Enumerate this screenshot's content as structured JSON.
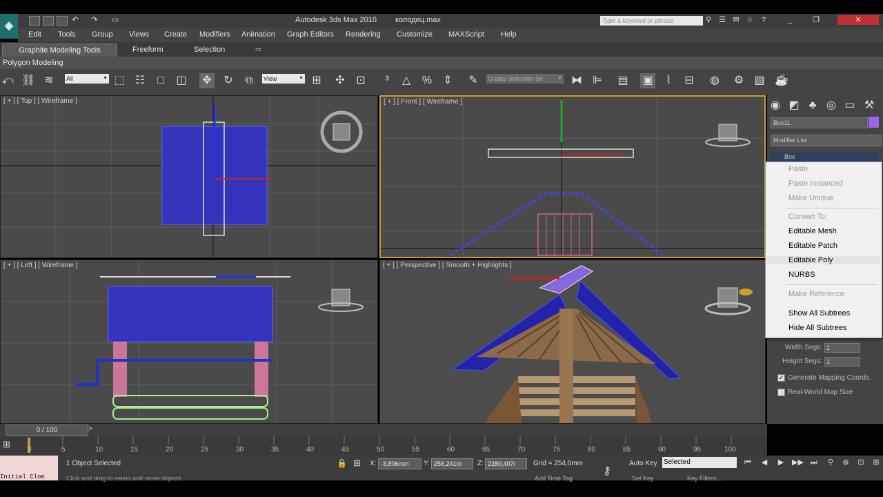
{
  "window": {
    "title": "Autodesk 3ds Max  2010",
    "file": "колодец.max",
    "search_placeholder": "Type a keyword or phrase"
  },
  "menu": [
    "Edit",
    "Tools",
    "Group",
    "Views",
    "Create",
    "Modifiers",
    "Animation",
    "Graph Editors",
    "Rendering",
    "Customize",
    "MAXScript",
    "Help"
  ],
  "ribbon": {
    "tabs": [
      "Graphite Modeling Tools",
      "Freeform",
      "Selection"
    ],
    "panel": "Polygon Modeling"
  },
  "toolbar": {
    "filter": "All",
    "ref_coord": "View",
    "named_selection": "Create Selection Se"
  },
  "viewports": {
    "top": "[ + ] [ Top ] [ Wireframe ]",
    "front": "[ + ] [ Front ] [ Wireframe ]",
    "left": "[ + ] [ Left ] [ Wireframe ]",
    "perspective": "[ + ] [ Perspective ] [ Smooth + Highlights ]"
  },
  "command_panel": {
    "object_name": "Box11",
    "modifier_list": "Modifier List",
    "stack_item": "Box",
    "object_color": "#9966ee",
    "params": {
      "width_segs_label": "Width Segs:",
      "width_segs": "2",
      "height_segs_label": "Height Segs:",
      "height_segs": "1",
      "gen_mapping": "Generate Mapping Coords.",
      "real_world": "Real-World Map Size"
    }
  },
  "context_menu": {
    "paste": "Paste",
    "paste_instanced": "Paste Instanced",
    "make_unique": "Make Unique",
    "convert_to": "Convert To:",
    "editable_mesh": "Editable Mesh",
    "editable_patch": "Editable Patch",
    "editable_poly": "Editable Poly",
    "nurbs": "NURBS",
    "make_reference": "Make Reference",
    "show_all_subtrees": "Show All Subtrees",
    "hide_all_subtrees": "Hide All Subtrees"
  },
  "timeline": {
    "frame": "0 / 100",
    "ticks": [
      "0",
      "5",
      "10",
      "15",
      "20",
      "25",
      "30",
      "35",
      "40",
      "45",
      "50",
      "55",
      "60",
      "65",
      "70",
      "75",
      "80",
      "85",
      "90",
      "95",
      "100"
    ]
  },
  "status": {
    "maxscript": "Initial Cloe",
    "selection": "1 Object Selected",
    "prompt": "Click and drag to select and move objects",
    "x_label": "X:",
    "x": "-3,806mm",
    "y_label": "Y:",
    "y": "256,241m",
    "z_label": "Z:",
    "z": "2280,407r",
    "grid": "Grid = 254,0mm",
    "auto_key": "Auto Key",
    "selected": "Selected",
    "set_key": "Set Key",
    "key_filters": "Key Filters...",
    "add_time_tag": "Add Time Tag"
  }
}
